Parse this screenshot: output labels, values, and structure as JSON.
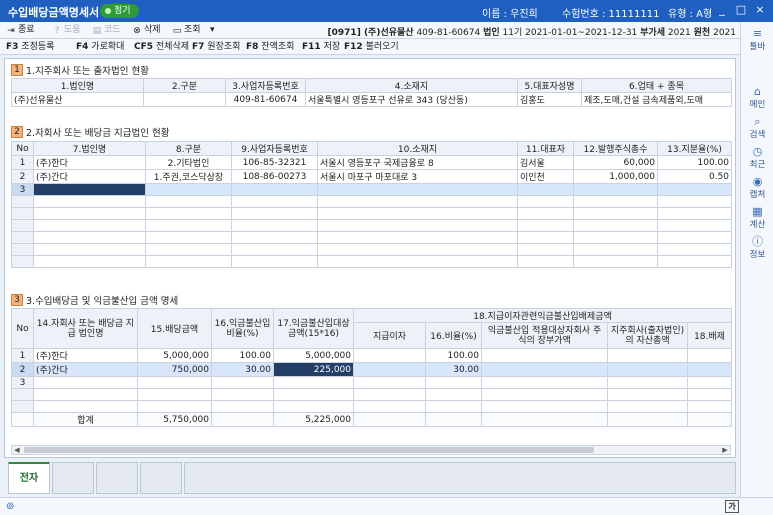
{
  "titlebar": {
    "title": "수입배당금액명세서",
    "badge": "정기",
    "name_label": "이름 : 우진희",
    "examno_label": "수험번호 : 11111111",
    "type_label": "유형 : A형",
    "controls": [
      "_",
      "□",
      "×"
    ]
  },
  "toolbar": {
    "close": "종료",
    "help": "도움",
    "code": "코드",
    "delete": "삭제",
    "lookup": "조회",
    "more": "▾",
    "company": "[0971] (주)선유물산",
    "bizno": "409-81-60674",
    "corp": "법인",
    "period": "11기 2021-01-01~2021-12-31",
    "vat_label": "부가세",
    "vat_year": "2021",
    "tax_label": "원천",
    "tax_year": "2021"
  },
  "fkeys": [
    {
      "key": "F3",
      "label": "조정등록"
    },
    {
      "key": "F4",
      "label": "가로확대"
    },
    {
      "key": "CF5",
      "label": "전체삭제"
    },
    {
      "key": "F7",
      "label": "원장조회"
    },
    {
      "key": "F8",
      "label": "잔액조회"
    },
    {
      "key": "F11",
      "label": "저장"
    },
    {
      "key": "F12",
      "label": "불러오기"
    }
  ],
  "section1": {
    "num": "1",
    "title": "1.지주회사 또는 출자법인 현황",
    "headers": [
      "1.법인명",
      "2.구분",
      "3.사업자등록번호",
      "4.소재지",
      "5.대표자성명",
      "6.업태 + 종목"
    ],
    "row": [
      "(주)선유물산",
      "",
      "409-81-60674",
      "서울특별시 영등포구 선유로 343 (당산동)",
      "김홍도",
      "제조,도매,건설 금속제품외,도매"
    ]
  },
  "section2": {
    "num": "2",
    "title": "2.자회사 또는 배당금 지급법인 현황",
    "headers": [
      "No",
      "7.법인명",
      "8.구분",
      "9.사업자등록번호",
      "10.소재지",
      "11.대표자",
      "12.발행주식총수",
      "13.지분율(%)"
    ],
    "rows": [
      [
        "1",
        "(주)한다",
        "2.기타법인",
        "106-85-32321",
        "서울시 영등포구 국제금융로 8",
        "김서울",
        "60,000",
        "100.00"
      ],
      [
        "2",
        "(주)간다",
        "1.주권,코스닥상장",
        "108-86-00273",
        "서울시 마포구 마포대로 3",
        "이인천",
        "1,000,000",
        "0.50"
      ],
      [
        "3",
        "",
        "",
        "",
        "",
        "",
        "",
        ""
      ]
    ]
  },
  "section3": {
    "num": "3",
    "title": "3.수입배당금 및 익금불산입 금액 명세",
    "headers": {
      "no": "No",
      "c14": "14.자회사 또는 배당금 지급 법인명",
      "c15": "15.배당금액",
      "c16": "16.익금불산입비율(%)",
      "c17": "17.익금불산입대상금액(15*16)",
      "c18": "18.지급이자관련익금불산입배제금액",
      "c18a": "지급이자",
      "c18b": "16.비율(%)",
      "c18c": "익금불산입 적용대상자회사 주식의 장부가액",
      "c18d": "지주회사(출자법인)의 자산총액",
      "c18e": "18.배제"
    },
    "rows": [
      [
        "1",
        "(주)한다",
        "5,000,000",
        "100.00",
        "5,000,000",
        "",
        "100.00",
        "",
        "",
        ""
      ],
      [
        "2",
        "(주)간다",
        "750,000",
        "30.00",
        "225,000",
        "",
        "30.00",
        "",
        "",
        ""
      ],
      [
        "3",
        "",
        "",
        "",
        "",
        "",
        "",
        "",
        "",
        ""
      ]
    ],
    "total": {
      "label": "합계",
      "c15": "5,750,000",
      "c17": "5,225,000"
    }
  },
  "bottom_tabs": [
    "전자"
  ],
  "status": {
    "ime": "가"
  },
  "sidebar": [
    {
      "icon": "≡",
      "label": "툴바"
    },
    {
      "icon": "⌂",
      "label": "메인"
    },
    {
      "icon": "⌕",
      "label": "검색"
    },
    {
      "icon": "◷",
      "label": "최근"
    },
    {
      "icon": "◉",
      "label": "캡처"
    },
    {
      "icon": "▦",
      "label": "계산"
    },
    {
      "icon": "ⓘ",
      "label": "정보"
    }
  ],
  "colors": {
    "title_bar": "#1f5fbf",
    "badge": "#2f9a3a",
    "section_num": "#f3b37a",
    "selected_row": "#d7e6fb",
    "active_cell": "#233e67"
  }
}
